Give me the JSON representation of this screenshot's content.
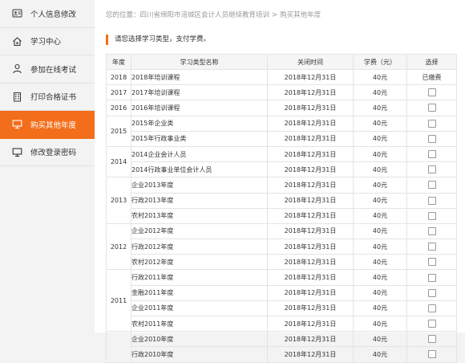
{
  "sidebar": {
    "items": [
      {
        "label": "个人信息修改",
        "icon": "person-card-icon",
        "active": false
      },
      {
        "label": "学习中心",
        "icon": "home-icon",
        "active": false
      },
      {
        "label": "参加在线考试",
        "icon": "user-icon",
        "active": false
      },
      {
        "label": "打印合格证书",
        "icon": "building-icon",
        "active": false
      },
      {
        "label": "购买其他年度",
        "icon": "monitor-icon",
        "active": true
      },
      {
        "label": "修改登录密码",
        "icon": "monitor-icon",
        "active": false
      }
    ]
  },
  "breadcrumb": {
    "prefix": "您的位置：",
    "path1": "四川省绵阳市涪城区会计人员继续教育培训",
    "separator": ">",
    "path2": "购买其他年度"
  },
  "notice": "请您选择学习类型，支付学费。",
  "table": {
    "headers": [
      "年度",
      "学习类型名称",
      "关闭时间",
      "学费（元）",
      "选择"
    ],
    "rows": [
      {
        "year": "2018",
        "span": 1,
        "name": "2018年培训课程",
        "date": "2018年12月31日",
        "fee": "40元",
        "status": "已缴费"
      },
      {
        "year": "2017",
        "span": 1,
        "name": "2017年培训课程",
        "date": "2018年12月31日",
        "fee": "40元",
        "status": ""
      },
      {
        "year": "2016",
        "span": 1,
        "name": "2016年培训课程",
        "date": "2018年12月31日",
        "fee": "40元",
        "status": ""
      },
      {
        "year": "2015",
        "span": 2,
        "name": "2015年企业类",
        "date": "2018年12月31日",
        "fee": "40元",
        "status": ""
      },
      {
        "year": "",
        "span": 0,
        "name": "2015年行政事业类",
        "date": "2018年12月31日",
        "fee": "40元",
        "status": ""
      },
      {
        "year": "2014",
        "span": 2,
        "name": "2014企业会计人员",
        "date": "2018年12月31日",
        "fee": "40元",
        "status": ""
      },
      {
        "year": "",
        "span": 0,
        "name": "2014行政事业单位会计人员",
        "date": "2018年12月31日",
        "fee": "40元",
        "status": ""
      },
      {
        "year": "2013",
        "span": 3,
        "name": "企业2013年度",
        "date": "2018年12月31日",
        "fee": "40元",
        "status": ""
      },
      {
        "year": "",
        "span": 0,
        "name": "行政2013年度",
        "date": "2018年12月31日",
        "fee": "40元",
        "status": ""
      },
      {
        "year": "",
        "span": 0,
        "name": "农村2013年度",
        "date": "2018年12月31日",
        "fee": "40元",
        "status": ""
      },
      {
        "year": "2012",
        "span": 3,
        "name": "企业2012年度",
        "date": "2018年12月31日",
        "fee": "40元",
        "status": ""
      },
      {
        "year": "",
        "span": 0,
        "name": "行政2012年度",
        "date": "2018年12月31日",
        "fee": "40元",
        "status": ""
      },
      {
        "year": "",
        "span": 0,
        "name": "农村2012年度",
        "date": "2018年12月31日",
        "fee": "40元",
        "status": ""
      },
      {
        "year": "2011",
        "span": 4,
        "name": "行政2011年度",
        "date": "2018年12月31日",
        "fee": "40元",
        "status": ""
      },
      {
        "year": "",
        "span": 0,
        "name": "金融2011年度",
        "date": "2018年12月31日",
        "fee": "40元",
        "status": ""
      },
      {
        "year": "",
        "span": 0,
        "name": "企业2011年度",
        "date": "2018年12月31日",
        "fee": "40元",
        "status": ""
      },
      {
        "year": "",
        "span": 0,
        "name": "农村2011年度",
        "date": "2018年12月31日",
        "fee": "40元",
        "status": ""
      },
      {
        "year": "",
        "span": 2,
        "name": "企业2010年度",
        "date": "2018年12月31日",
        "fee": "40元",
        "status": ""
      },
      {
        "year": "",
        "span": 0,
        "name": "行政2010年度",
        "date": "2018年12月31日",
        "fee": "40元",
        "status": ""
      }
    ]
  },
  "colors": {
    "accent": "#f36e1a",
    "sidebar_bg": "#f3f3f3",
    "border": "#e4e4e4"
  }
}
